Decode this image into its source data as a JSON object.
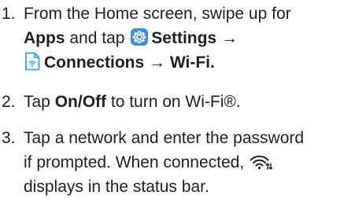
{
  "steps": [
    {
      "number": "1.",
      "line1": "From the Home screen, swipe up for",
      "apps": "Apps",
      "and_tap": "and tap",
      "settings": "Settings",
      "arrow1": "→",
      "connections": "Connections",
      "arrow2": "→",
      "wifi": "Wi-Fi."
    },
    {
      "number": "2.",
      "tap": "Tap",
      "onoff": "On/Off",
      "rest": "to turn on Wi-Fi®."
    },
    {
      "number": "3.",
      "line1": "Tap a network and enter the password",
      "line2": "if prompted. When connected,",
      "line3": "displays in the status bar."
    }
  ],
  "icons": {
    "settings": "gear-icon",
    "connections": "connections-icon",
    "wifi": "wifi-icon"
  },
  "colors": {
    "text": "#231f20",
    "settings_icon_bg": "#3d8fdc",
    "connections_icon": "#3aa6dd"
  }
}
